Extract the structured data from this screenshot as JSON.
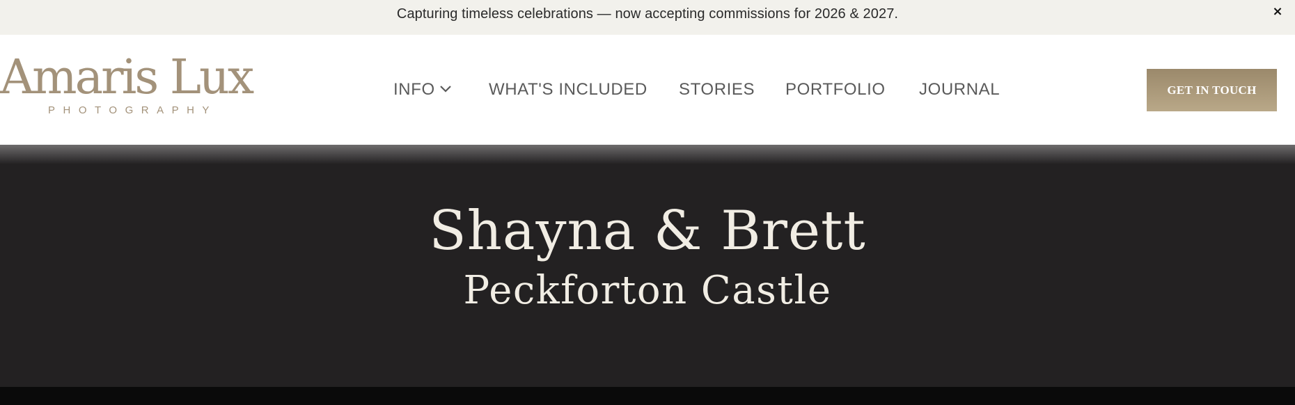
{
  "announcement": {
    "text": "Capturing timeless celebrations — now accepting commissions for 2026 & 2027.",
    "close_label": "×"
  },
  "header": {
    "logo": {
      "name": "Amaris Lux",
      "tagline": "PHOTOGRAPHY"
    },
    "nav": [
      {
        "label": "INFO",
        "has_dropdown": true,
        "icon": "chevron-down-icon"
      },
      {
        "label": "WHAT'S INCLUDED"
      },
      {
        "label": "STORIES"
      },
      {
        "label": "PORTFOLIO"
      },
      {
        "label": "JOURNAL"
      }
    ],
    "cta_label": "GET IN TOUCH"
  },
  "hero": {
    "title": "Shayna & Brett",
    "subtitle": "Peckforton Castle"
  },
  "colors": {
    "announcement_bg": "#f2f1ec",
    "brand_gold": "#a3927a",
    "hero_bg": "#232122",
    "hero_text": "#f1ede4"
  }
}
